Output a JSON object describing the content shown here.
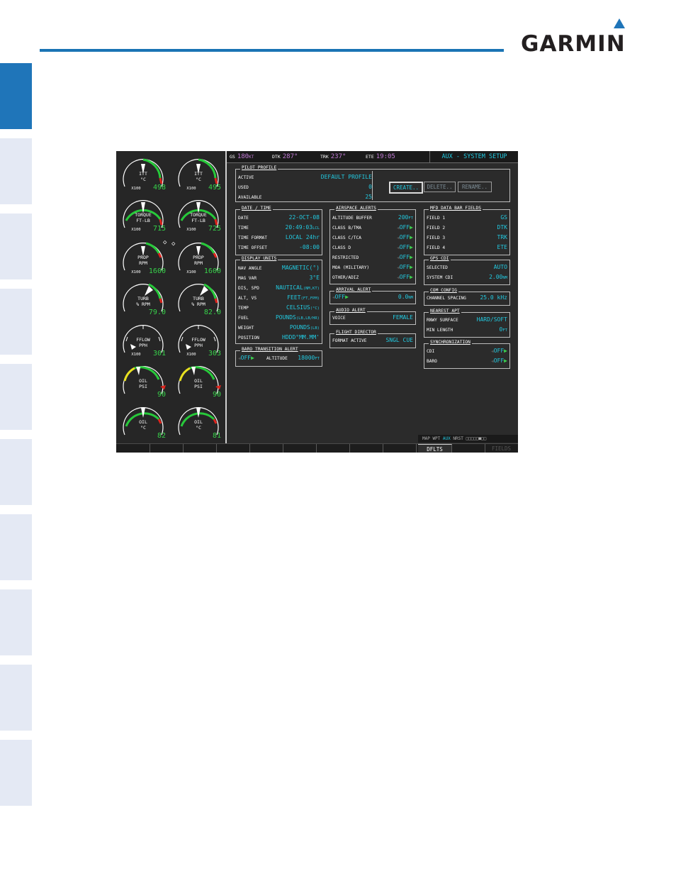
{
  "brand": {
    "name": "GARMIN"
  },
  "colors": {
    "accent": "#1f75b9",
    "cyan": "#22c9e0",
    "green": "#37d24a",
    "magenta": "#c07ad4",
    "tab_inactive": "#e4e9f4"
  },
  "side_tabs": [
    {
      "active": true
    },
    {
      "active": false
    },
    {
      "active": false
    },
    {
      "active": false
    },
    {
      "active": false
    },
    {
      "active": false
    },
    {
      "active": false
    },
    {
      "active": false
    },
    {
      "active": false
    },
    {
      "active": false
    }
  ],
  "navbar": {
    "gs_label": "GS",
    "gs_value": "180",
    "gs_unit": "KT",
    "dtk_label": "DTK",
    "dtk_value": "287°",
    "trk_label": "TRK",
    "trk_value": "237°",
    "ete_label": "ETE",
    "ete_value": "19:05",
    "page_title": "AUX - SYSTEM SETUP"
  },
  "engine": {
    "itt_label": "ITT\n°C",
    "itt_unit": "X100",
    "itt_left": "498",
    "itt_right": "495",
    "torque_label": "TORQUE\nFT-LB",
    "torque_unit": "X100",
    "torque_left": "715",
    "torque_right": "725",
    "prop_label": "PROP\nRPM",
    "prop_unit": "X100",
    "prop_left": "1600",
    "prop_right": "1600",
    "turb_label": "TURB\n% RPM",
    "turb_left": "79.0",
    "turb_right": "82.0",
    "fflow_label": "FFLOW\nPPH",
    "fflow_unit": "X100",
    "fflow_left": "301",
    "fflow_right": "303",
    "oilpsi_label": "OIL\nPSI",
    "oilpsi_left": "90",
    "oilpsi_right": "90",
    "oilc_label": "OIL\n°C",
    "oilc_left": "82",
    "oilc_right": "81",
    "diamond_sym": "◇"
  },
  "pilot_profile": {
    "title": "PILOT PROFILE",
    "active_label": "ACTIVE",
    "active_value": "DEFAULT PROFILE",
    "used_label": "USED",
    "used_value": "0",
    "available_label": "AVAILABLE",
    "available_value": "25",
    "create_label": "CREATE..",
    "delete_label": "DELETE..",
    "rename_label": "RENAME.."
  },
  "date_time": {
    "title": "DATE / TIME",
    "date_label": "DATE",
    "date_value": "22-OCT-08",
    "time_label": "TIME",
    "time_value": "20:49:03",
    "time_unit": "LCL",
    "format_label": "TIME FORMAT",
    "format_value": "LOCAL 24hr",
    "offset_label": "TIME OFFSET",
    "offset_value": "-08:00"
  },
  "display_units": {
    "title": "DISPLAY UNITS",
    "nav_angle_label": "NAV ANGLE",
    "nav_angle_value": "MAGNETIC(°)",
    "mag_var_label": "MAG VAR",
    "mag_var_value": "3°E",
    "dis_spd_label": "DIS, SPD",
    "dis_spd_value": "NAUTICAL",
    "dis_spd_sub": "(NM,KT)",
    "alt_vs_label": "ALT, VS",
    "alt_vs_value": "FEET",
    "alt_vs_sub": "(FT,FPM)",
    "temp_label": "TEMP",
    "temp_value": "CELSIUS",
    "temp_sub": "(°C)",
    "fuel_label": "FUEL",
    "fuel_value": "POUNDS",
    "fuel_sub": "(LB,LB/HR)",
    "weight_label": "WEIGHT",
    "weight_value": "POUNDS",
    "weight_sub": "(LB)",
    "position_label": "POSITION",
    "position_value": "HDDD°MM.MM'"
  },
  "baro_alert": {
    "title": "BARO TRANSITION ALERT",
    "state": "OFF",
    "altitude_label": "ALTITUDE",
    "altitude_value": "18000",
    "altitude_unit": "FT"
  },
  "airspace_alerts": {
    "title": "AIRSPACE ALERTS",
    "buffer_label": "ALTITUDE BUFFER",
    "buffer_value": "200",
    "buffer_unit": "FT",
    "b_label": "CLASS B/TMA",
    "b_value": "OFF",
    "c_label": "CLASS C/TCA",
    "c_value": "OFF",
    "d_label": "CLASS D",
    "d_value": "OFF",
    "restricted_label": "RESTRICTED",
    "restricted_value": "OFF",
    "moa_label": "MOA (MILITARY)",
    "moa_value": "OFF",
    "other_label": "OTHER/ADIZ",
    "other_value": "OFF"
  },
  "arrival_alert": {
    "title": "ARRIVAL ALERT",
    "state": "OFF",
    "value": "0.0",
    "unit": "NM"
  },
  "audio_alert": {
    "title": "AUDIO ALERT",
    "voice_label": "VOICE",
    "voice_value": "FEMALE"
  },
  "flight_director": {
    "title": "FLIGHT DIRECTOR",
    "format_label": "FORMAT ACTIVE",
    "format_value": "SNGL CUE"
  },
  "mfd_data_bar": {
    "title": "MFD DATA BAR FIELDS",
    "f1_label": "FIELD 1",
    "f1_value": "GS",
    "f2_label": "FIELD 2",
    "f2_value": "DTK",
    "f3_label": "FIELD 3",
    "f3_value": "TRK",
    "f4_label": "FIELD 4",
    "f4_value": "ETE"
  },
  "gps_cdi": {
    "title": "GPS CDI",
    "selected_label": "SELECTED",
    "selected_value": "AUTO",
    "system_label": "SYSTEM CDI",
    "system_value": "2.00",
    "system_unit": "NM"
  },
  "com_config": {
    "title": "COM CONFIG",
    "spacing_label": "CHANNEL SPACING",
    "spacing_value": "25.0 kHz"
  },
  "nearest_apt": {
    "title": "NEAREST APT",
    "surface_label": "RNWY SURFACE",
    "surface_value": "HARD/SOFT",
    "min_label": "MIN LENGTH",
    "min_value": "0",
    "min_unit": "FT"
  },
  "synchronization": {
    "title": "SYNCHRONIZATION",
    "cdi_label": "CDI",
    "cdi_value": "OFF",
    "baro_label": "BARO",
    "baro_value": "OFF"
  },
  "page_group": {
    "prefix": "MAP WPT",
    "current": "AUX",
    "suffix": "NRST",
    "boxes": "□□□□□■□□"
  },
  "softkeys": {
    "dflts": "DFLTS",
    "fields": "FIELDS"
  }
}
